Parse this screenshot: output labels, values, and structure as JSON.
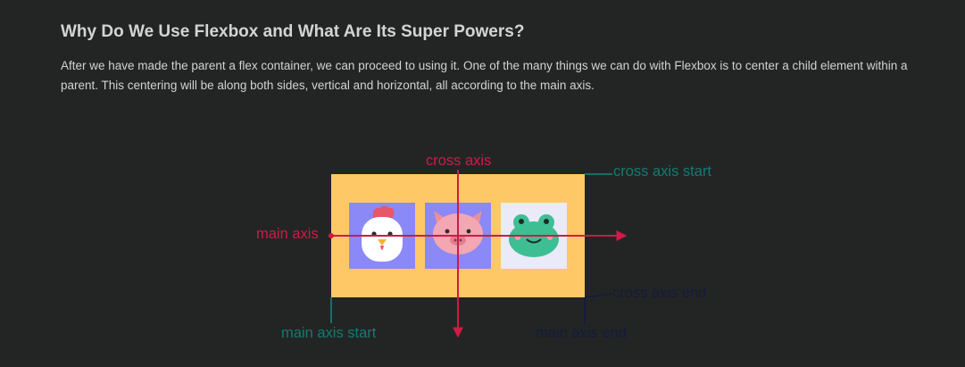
{
  "article": {
    "heading": "Why Do We Use Flexbox and What Are Its Super Powers?",
    "paragraph": "After we have made the parent a flex container, we can proceed to using it. One of the many things we can do with Flexbox is to center a child element within a parent. This centering will be along both sides, vertical and horizontal, all according to the main axis."
  },
  "diagram": {
    "labels": {
      "cross_axis": "cross axis",
      "cross_axis_start": "cross axis start",
      "main_axis": "main axis",
      "main_axis_start": "main axis start",
      "cross_axis_end": "cross axis end",
      "main_axis_end": "main axis end"
    },
    "items": [
      {
        "icon": "chicken-icon"
      },
      {
        "icon": "pig-icon"
      },
      {
        "icon": "frog-icon"
      }
    ],
    "colors": {
      "container": "#ffc867",
      "item_bg": "#8b88f7",
      "frog_bg": "#eaeaf8",
      "axis": "#cc1c47",
      "start": "#147a72",
      "end": "#141c3c"
    }
  }
}
